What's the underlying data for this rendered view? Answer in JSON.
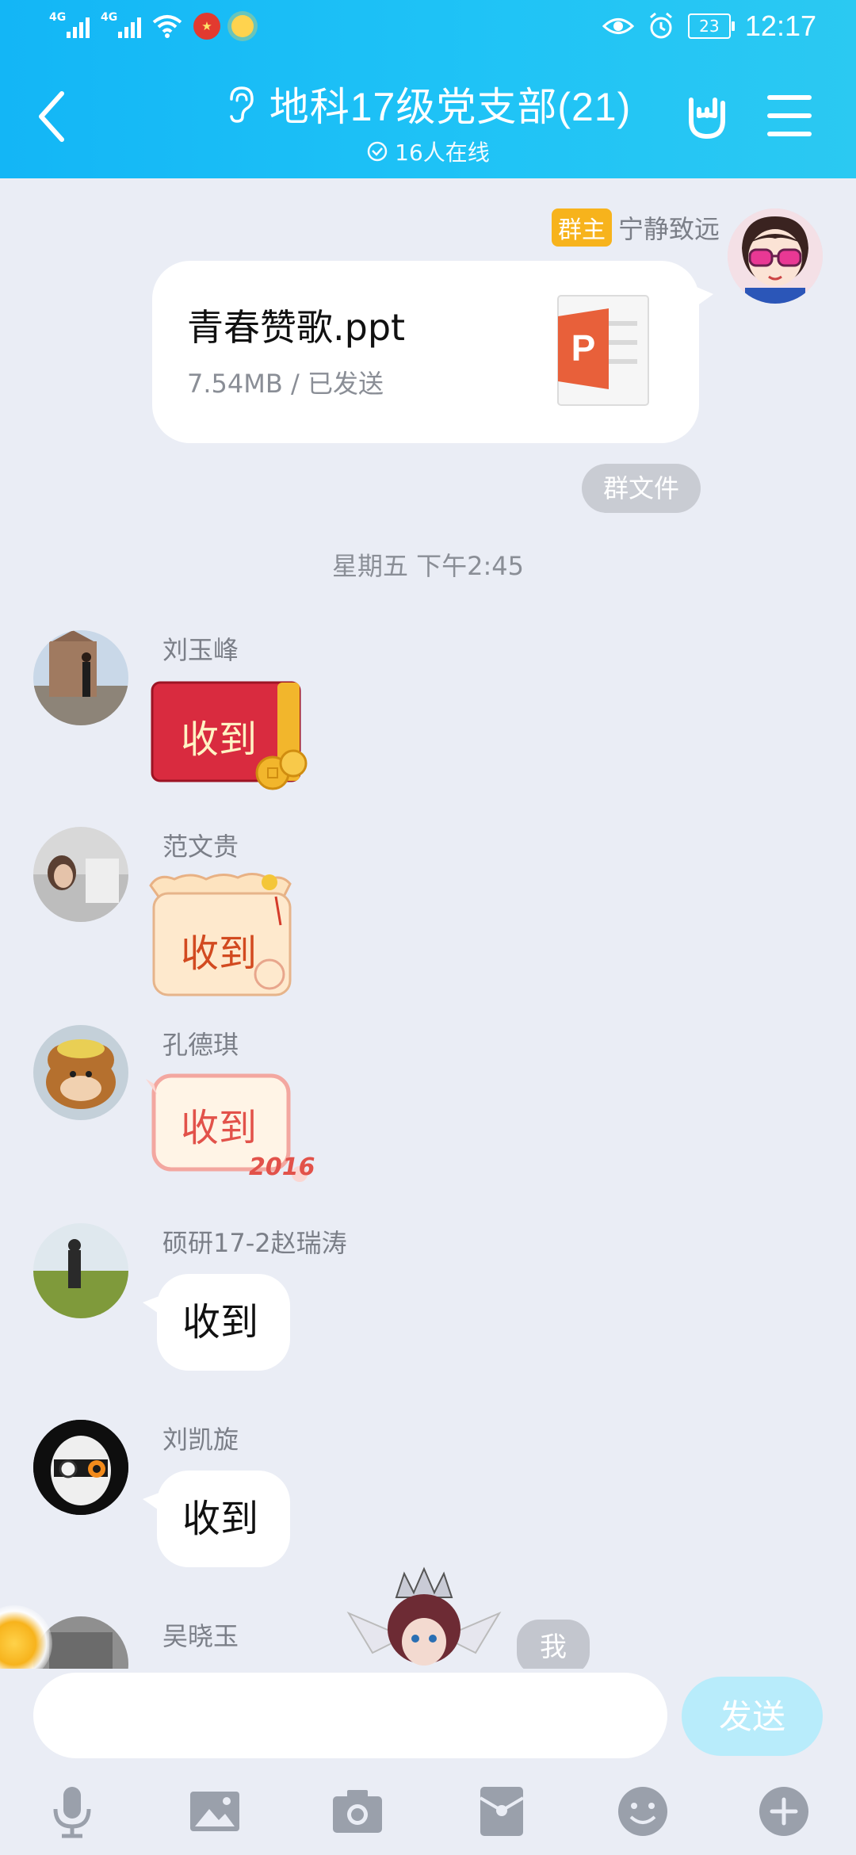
{
  "status_bar": {
    "sim1": "4G",
    "sim2": "4G",
    "battery": "23",
    "time": "12:17"
  },
  "header": {
    "title": "地科17级党支部(21)",
    "online": "16人在线"
  },
  "messages": {
    "file_message": {
      "owner_badge": "群主",
      "sender": "宁静致远",
      "file_name": "青春赞歌.ppt",
      "file_meta": "7.54MB / 已发送",
      "tag": "群文件"
    },
    "time_divider": "星期五 下午2:45",
    "replies": [
      {
        "sender": "刘玉峰",
        "text": "收到"
      },
      {
        "sender": "范文贵",
        "text": "收到"
      },
      {
        "sender": "孔德琪",
        "text": "收到"
      },
      {
        "sender": "硕研17-2赵瑞涛",
        "text": "收到"
      },
      {
        "sender": "刘凯旋",
        "text": "收到"
      },
      {
        "sender": "吴晓玉"
      }
    ],
    "sticker_year": "2016",
    "me_label": "我"
  },
  "input": {
    "placeholder": "",
    "send_label": "发送"
  },
  "colors": {
    "header_start": "#13b6f6",
    "header_end": "#2bc9f2",
    "background": "#eaedf5",
    "owner_badge": "#f7b31c",
    "red_packet": "#d92b3f",
    "send_disabled": "#b8ecfb",
    "ppt_orange": "#e8603a"
  },
  "icons": {
    "toolbar": [
      "microphone-icon",
      "image-icon",
      "camera-icon",
      "red-packet-icon",
      "emoji-icon",
      "plus-icon"
    ]
  }
}
